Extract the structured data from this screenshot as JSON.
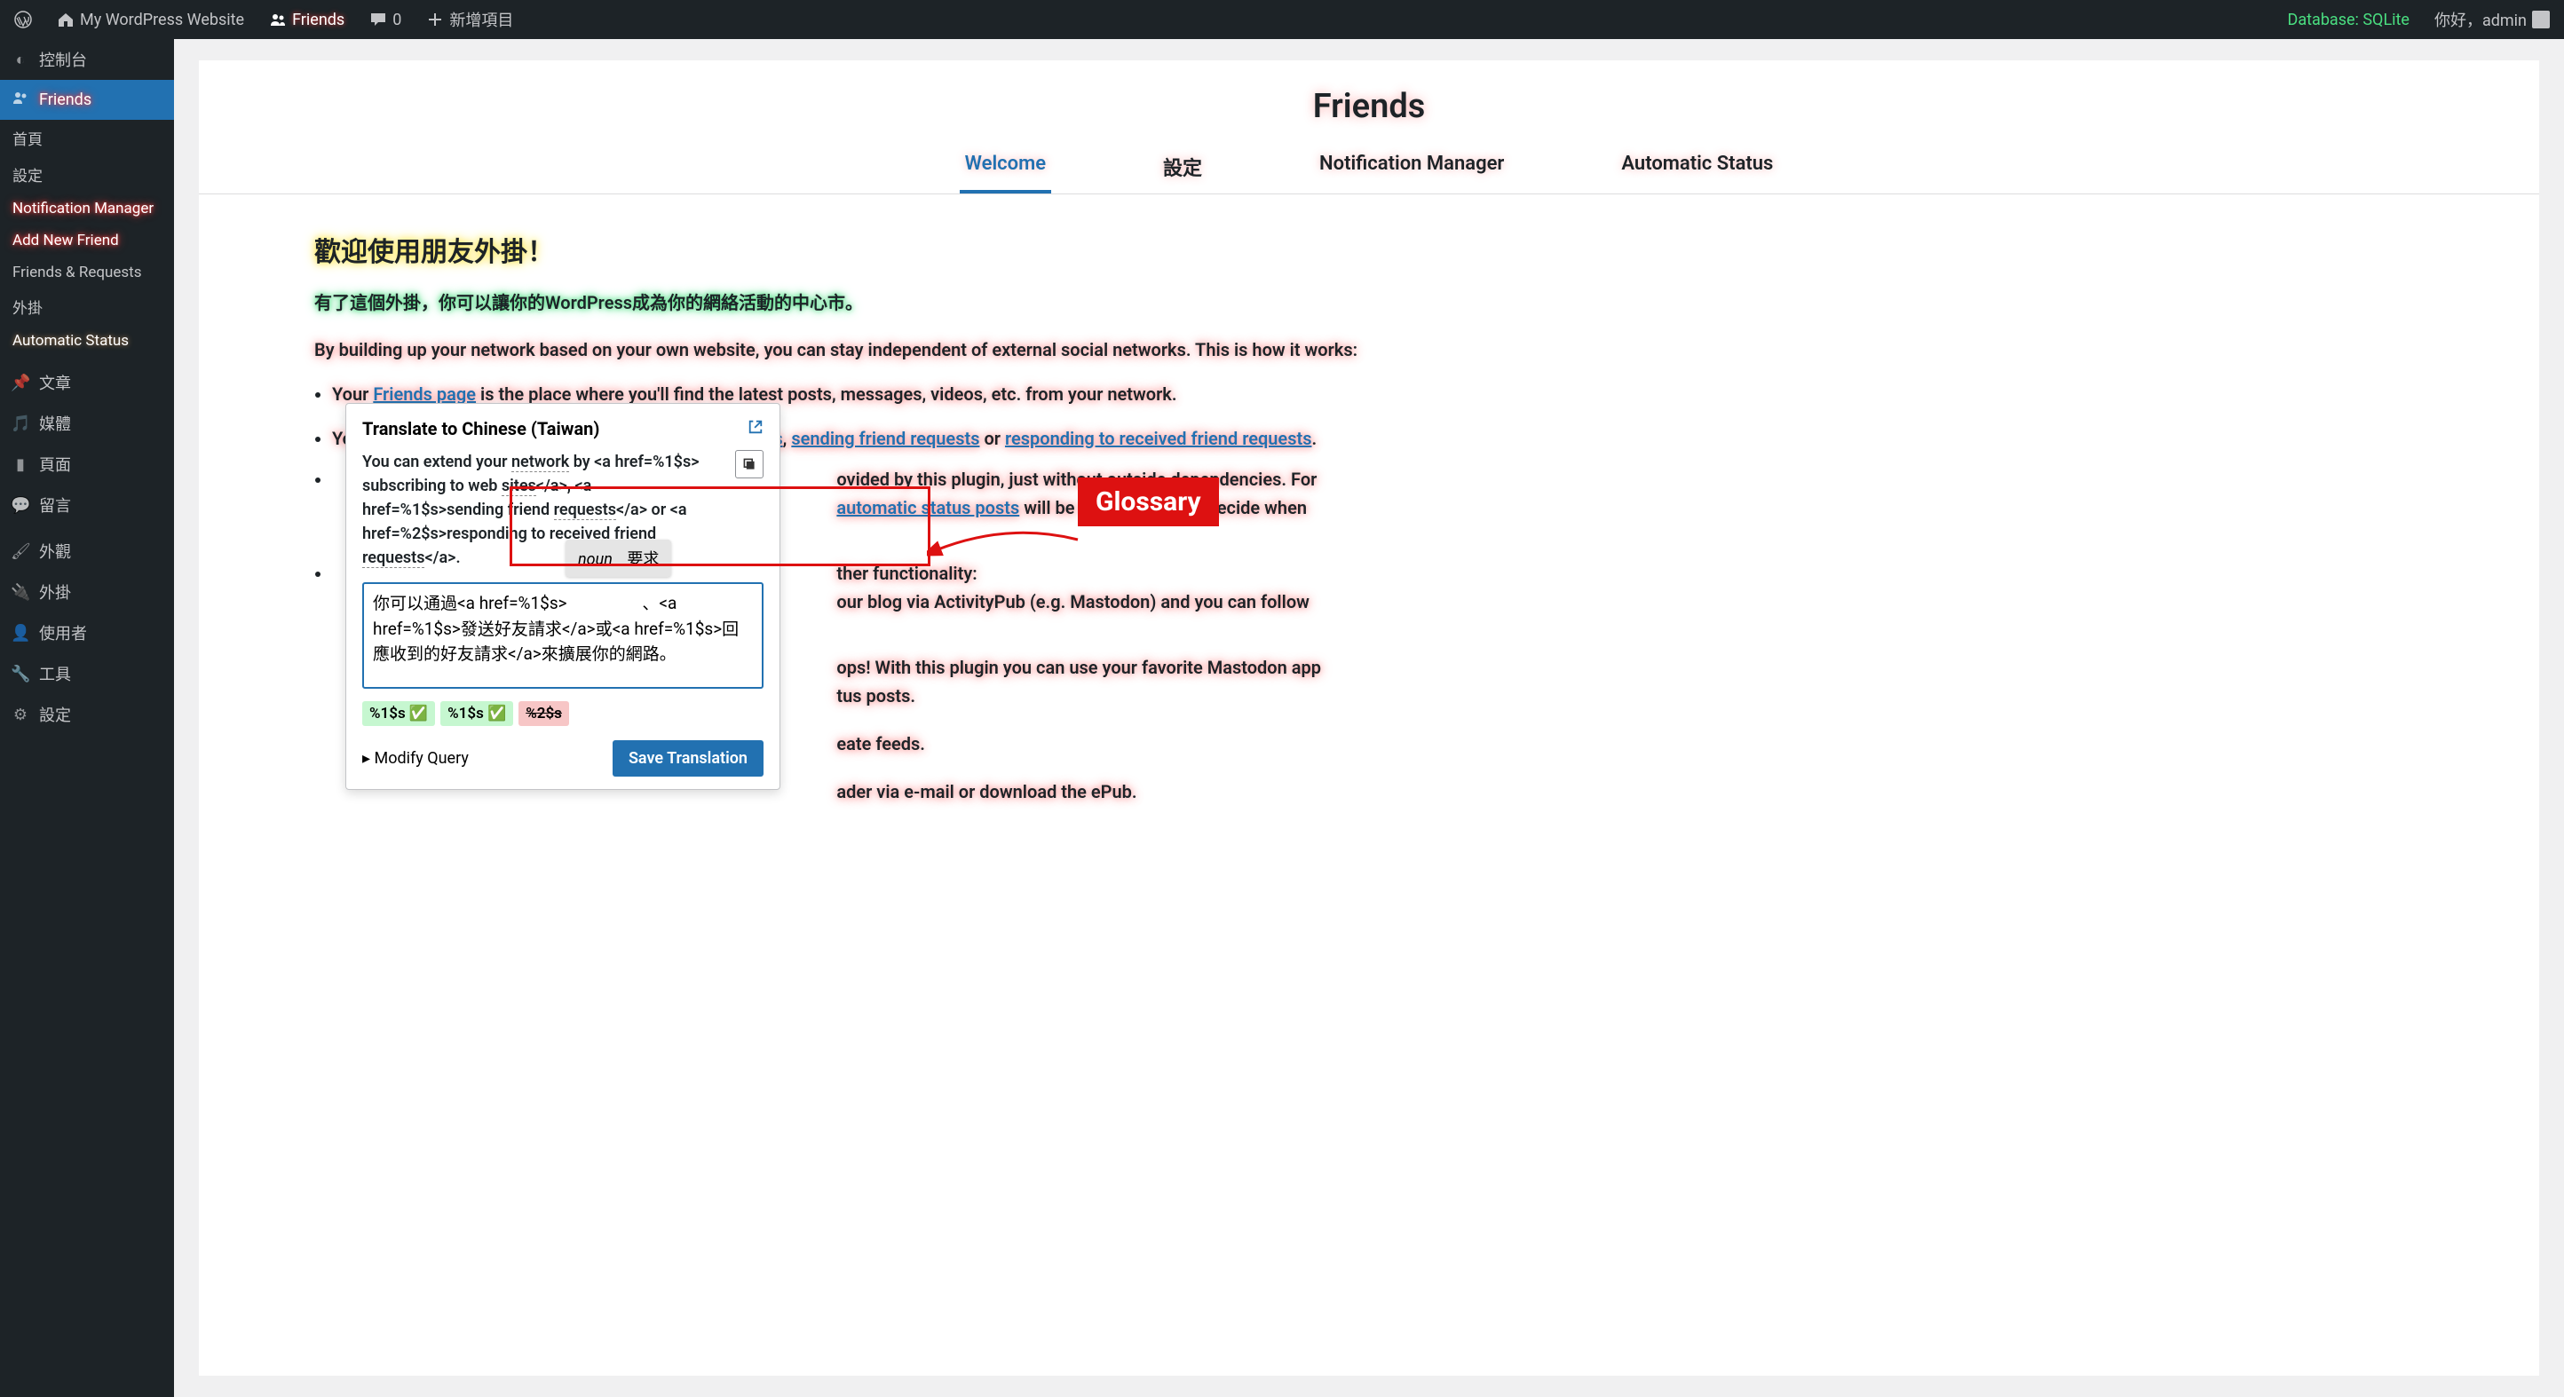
{
  "adminbar": {
    "site_name": "My WordPress Website",
    "friends": "Friends",
    "comments_count": "0",
    "new_item": "新增項目",
    "database": "Database: SQLite",
    "greeting": "你好，admin"
  },
  "sidebar": {
    "dashboard": "控制台",
    "friends": "Friends",
    "sub": {
      "home": "首頁",
      "settings": "設定",
      "notif": "Notification Manager",
      "addnew": "Add New Friend",
      "freq": "Friends & Requests",
      "plugin": "外掛",
      "autostatus": "Automatic Status"
    },
    "posts": "文章",
    "media": "媒體",
    "pages": "頁面",
    "comments": "留言",
    "appearance": "外觀",
    "plugins": "外掛",
    "users": "使用者",
    "tools": "工具",
    "settings": "設定"
  },
  "panel": {
    "title": "Friends",
    "tabs": {
      "welcome": "Welcome",
      "settings": "設定",
      "notif": "Notification Manager",
      "autostatus": "Automatic Status"
    }
  },
  "content": {
    "h2": "歡迎使用朋友外掛！",
    "pgreen": "有了這個外掛，你可以讓你的WordPress成為你的網絡活動的中心市。",
    "p1": "By building up your network based on your own website, you can stay independent of external social networks. This is how it works:",
    "li1_a": "Your ",
    "li1_link": "Friends page",
    "li1_b": " is the place where you'll find the latest posts, messages, videos, etc. from your network.",
    "li2_a": "You can extend your network by ",
    "li2_link1": "subscribing to web sites",
    "li2_m1": ", ",
    "li2_link2": "sending friend requests",
    "li2_m2": " or ",
    "li2_link3": "responding to received friend requests",
    "li2_end": ".",
    "li3_frag1": "ovided by this plugin, just without outside dependencies. For",
    "li3_link": "automatic status posts",
    "li3_frag2": " will be created but you decide when",
    "li4_frag": "ther functionality:",
    "li5_frag": "our blog via ActivityPub (e.g. Mastodon) and you can follow",
    "li6_frag": "ops! With this plugin you can use your favorite Mastodon app",
    "li6_frag2": "tus posts.",
    "li7_frag": "eate feeds.",
    "li8_frag": "ader via e-mail or download the ePub."
  },
  "popup": {
    "title": "Translate to Chinese (Taiwan)",
    "source": "You can extend your network by <a href=%1$s> subscribing to web sites</a>, <a href=%1$s>sending friend requests</a> or <a href=%2$s>responding to received friend requests</a>.",
    "translation": "你可以通過<a href=%1$s>                  、<a href=%1$s>發送好友請求</a>或<a href=%1$s>回應收到的好友請求</a>來擴展你的網路。",
    "tok1": "%1$s ✅",
    "tok2": "%1$s ✅",
    "tok3": "%2$s",
    "modify": "▸ Modify Query",
    "save": "Save Translation"
  },
  "glossary": {
    "pos": "noun",
    "term": "要求"
  },
  "annotation": {
    "label": "Glossary"
  }
}
